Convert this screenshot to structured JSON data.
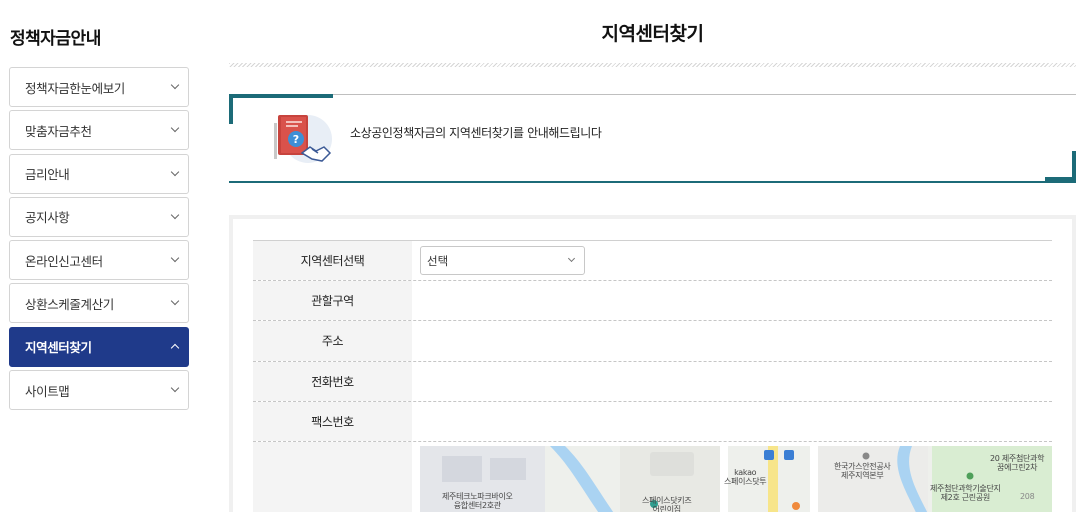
{
  "sidebar": {
    "title": "정책자금안내",
    "items": [
      {
        "label": "정책자금한눈에보기",
        "active": false
      },
      {
        "label": "맞춤자금추천",
        "active": false
      },
      {
        "label": "금리안내",
        "active": false
      },
      {
        "label": "공지사항",
        "active": false
      },
      {
        "label": "온라인신고센터",
        "active": false
      },
      {
        "label": "상환스케줄계산기",
        "active": false
      },
      {
        "label": "지역센터찾기",
        "active": true
      },
      {
        "label": "사이트맵",
        "active": false
      }
    ]
  },
  "main": {
    "title": "지역센터찾기",
    "intro_text": "소상공인정책자금의 지역센터찾기를 안내해드립니다",
    "form": {
      "center_label": "지역센터선택",
      "center_select_value": "선택",
      "district_label": "관할구역",
      "address_label": "주소",
      "phone_label": "전화번호",
      "fax_label": "팩스번호"
    },
    "map": {
      "labels": {
        "jeju_techno": "제주테크노파크바이오\n융합센터2호관",
        "kakao": "kakao\n스페이스닷투",
        "space_kids": "스페이스닷키즈\n어린이집",
        "gas_safety": "한국가스안전공사\n제주지역본부",
        "cheomdan_1": "20 제주첨단과학\n꿈에그린2차",
        "cheomdan_2": "제주첨단과학기술단지\n제2호 근린공원",
        "route_no": "208"
      }
    }
  },
  "colors": {
    "active_menu": "#1f3a8a",
    "accent_teal": "#1c6b78"
  }
}
